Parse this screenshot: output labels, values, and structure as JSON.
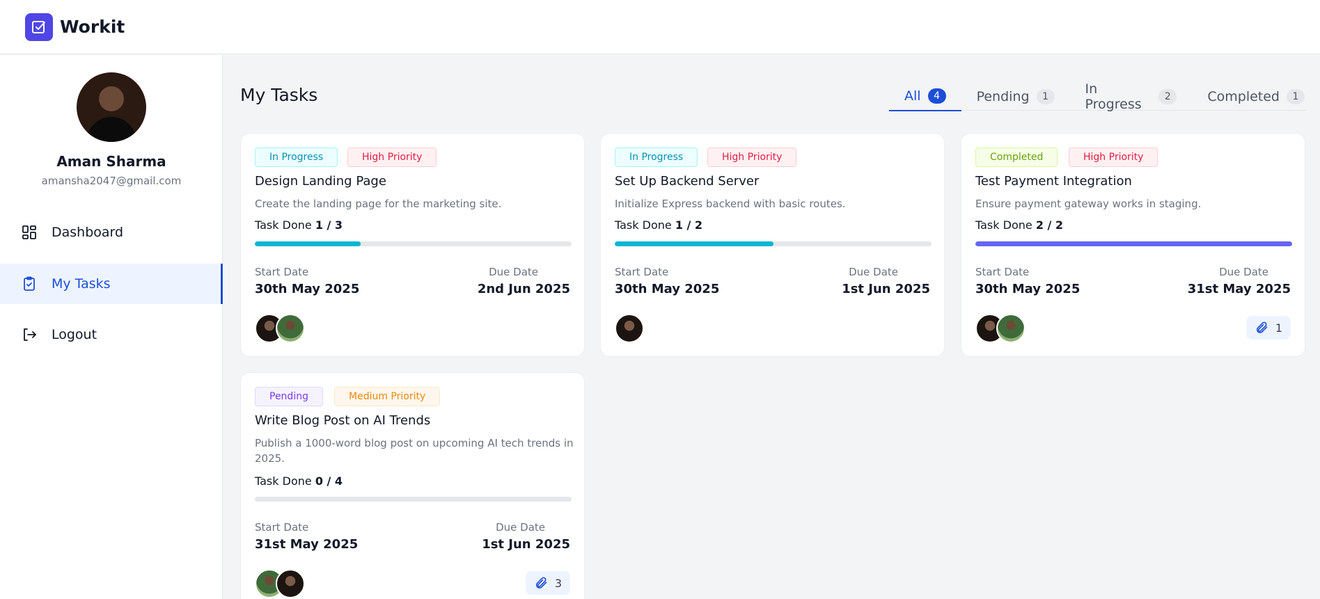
{
  "app": {
    "name": "Workit",
    "accent": "#4f46e5"
  },
  "profile": {
    "name": "Aman Sharma",
    "email": "amansha2047@gmail.com"
  },
  "nav": [
    {
      "label": "Dashboard",
      "icon": "dashboard-grid-icon",
      "active": false
    },
    {
      "label": "My Tasks",
      "icon": "clipboard-check-icon",
      "active": true
    },
    {
      "label": "Logout",
      "icon": "logout-icon",
      "active": false
    }
  ],
  "page": {
    "title": "My Tasks"
  },
  "tabs": [
    {
      "label": "All",
      "count": "4",
      "active": true
    },
    {
      "label": "Pending",
      "count": "1",
      "active": false
    },
    {
      "label": "In Progress",
      "count": "2",
      "active": false
    },
    {
      "label": "Completed",
      "count": "1",
      "active": false
    }
  ],
  "labels": {
    "task_done": "Task Done",
    "start_date": "Start Date",
    "due_date": "Due Date"
  },
  "tasks": [
    {
      "status": "In Progress",
      "priority": "High Priority",
      "title": "Design Landing Page",
      "description": "Create the landing page for the marketing site.",
      "done": "1 / 3",
      "progress": 0.333,
      "progress_color": "#06b6d4",
      "start": "30th May 2025",
      "due": "2nd Jun 2025",
      "assignees": 2,
      "attachments": ""
    },
    {
      "status": "In Progress",
      "priority": "High Priority",
      "title": "Set Up Backend Server",
      "description": "Initialize Express backend with basic routes.",
      "done": "1 / 2",
      "progress": 0.5,
      "progress_color": "#06b6d4",
      "start": "30th May 2025",
      "due": "1st Jun 2025",
      "assignees": 1,
      "attachments": ""
    },
    {
      "status": "Completed",
      "priority": "High Priority",
      "title": "Test Payment Integration",
      "description": "Ensure payment gateway works in staging.",
      "done": "2 / 2",
      "progress": 1.0,
      "progress_color": "#6366f1",
      "start": "30th May 2025",
      "due": "31st May 2025",
      "assignees": 2,
      "attachments": "1"
    },
    {
      "status": "Pending",
      "priority": "Medium Priority",
      "title": "Write Blog Post on AI Trends",
      "description": "Publish a 1000-word blog post on upcoming AI tech trends in 2025.",
      "done": "0 / 4",
      "progress": 0.0,
      "progress_color": "#6366f1",
      "start": "31st May 2025",
      "due": "1st Jun 2025",
      "assignees": 2,
      "attachments": "3"
    }
  ]
}
